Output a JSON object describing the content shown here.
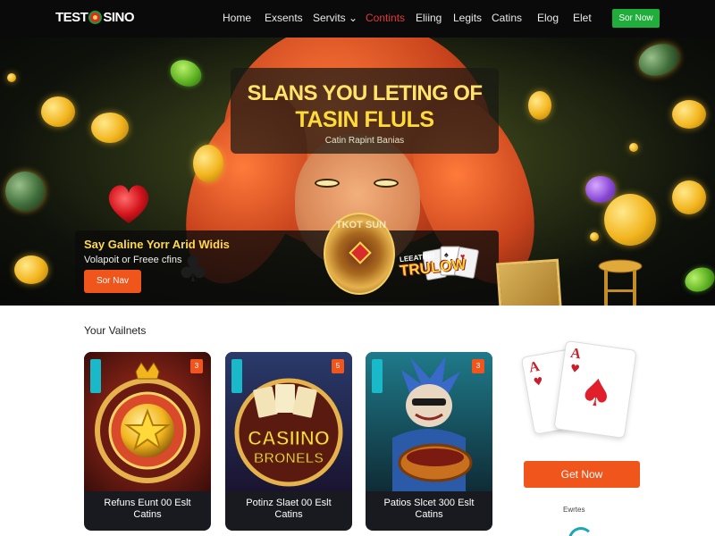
{
  "nav": {
    "logo_text_a": "TEST",
    "logo_text_b": "SINO",
    "items": [
      {
        "label": "Home"
      },
      {
        "label": "Exsents"
      },
      {
        "label": "Servits ⌄"
      },
      {
        "label": "Contints"
      },
      {
        "label": "Eliing"
      },
      {
        "label": "Legits"
      },
      {
        "label": "Catins"
      },
      {
        "label": "Elog"
      },
      {
        "label": "Elet"
      }
    ],
    "cta_label": "Sor Now",
    "active_index": 3
  },
  "hero": {
    "headline_1": "SLANS YOU LETING OF",
    "headline_2": "TASIN FLULS",
    "subtitle": "Catin Rapint Banias",
    "emblem_label": "TKOT SUN",
    "sign_small": "LEEATING",
    "sign_big": "TRULOW",
    "promo": {
      "title": "Say Galine Yorr Arid Widis",
      "text": "Volapoit or Freee cfins",
      "button_label": "Sor Nav"
    }
  },
  "section": {
    "title": "Your Vailnets",
    "cards": [
      {
        "caption_1": "Refuns Eunt 00 Eslt",
        "caption_2": "Catins",
        "badge": "3"
      },
      {
        "caption_1": "Potinz Slaet 00 Eslt",
        "caption_2": "Catins",
        "badge": "5",
        "art_text_1": "CASIINO",
        "art_text_2": "BRONELS"
      },
      {
        "caption_1": "Patios Slcet 300 Eslt",
        "caption_2": "Catins",
        "badge": "3"
      }
    ],
    "side": {
      "ace_letter": "A",
      "button_label": "Get Now",
      "small_text": "Ewrtes"
    }
  },
  "colors": {
    "accent_orange": "#f0551c",
    "nav_green": "#1fae3b",
    "nav_active": "#e23a3a",
    "hero_yellow": "#ffdb3a"
  }
}
